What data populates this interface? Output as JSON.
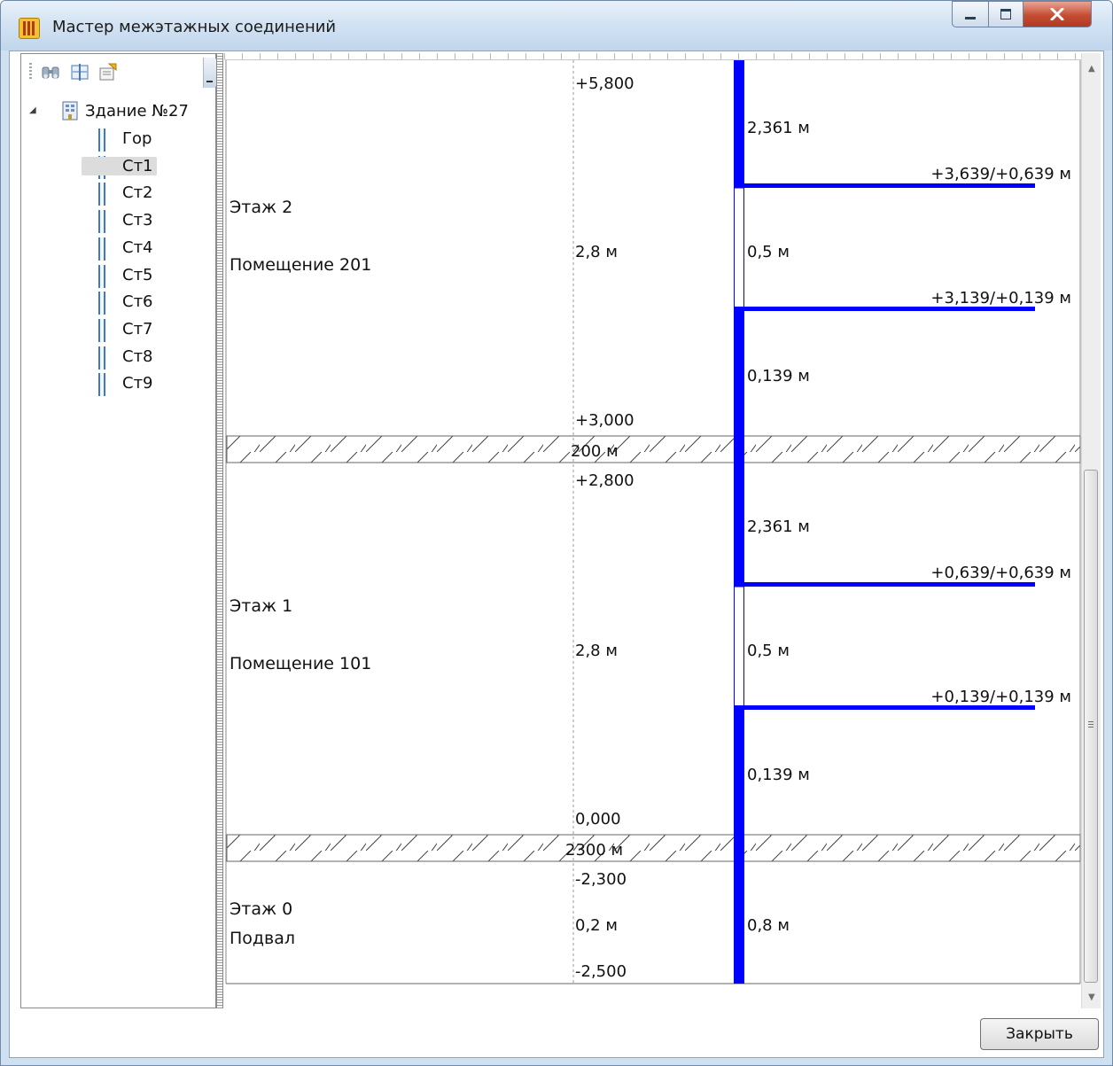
{
  "window": {
    "title": "Мастер межэтажных соединений"
  },
  "toolbar": {
    "icons": [
      "binoculars-icon",
      "split-view-icon",
      "properties-icon"
    ]
  },
  "tree": {
    "building": "Здание №27",
    "items": [
      "Гор",
      "Ст1",
      "Ст2",
      "Ст3",
      "Ст4",
      "Ст5",
      "Ст6",
      "Ст7",
      "Ст8",
      "Ст9"
    ],
    "selected": "Ст1"
  },
  "diagram": {
    "floors": [
      {
        "name": "Этаж 2",
        "room": "Помещение 201",
        "top_mark": "+5,800",
        "height": "2,8 м",
        "bottom_mark": "+3,000",
        "upper_segment": "2,361 м",
        "mid_segment": "0,5 м",
        "lower_segment": "0,139 м",
        "upper_outlet": "+3,639/+0,639 м",
        "lower_outlet": "+3,139/+0,139 м"
      },
      {
        "name": "Этаж 1",
        "room": "Помещение 101",
        "top_mark": "+2,800",
        "height": "2,8 м",
        "bottom_mark": "0,000",
        "upper_segment": "2,361 м",
        "mid_segment": "0,5 м",
        "lower_segment": "0,139 м",
        "upper_outlet": "+0,639/+0,639 м",
        "lower_outlet": "+0,139/+0,139 м"
      },
      {
        "name": "Этаж 0",
        "room": "Подвал",
        "top_mark": "-2,300",
        "height": "0,2 м",
        "bottom_mark": "-2,500",
        "segment": "0,8 м"
      }
    ],
    "slabs": [
      "200 м",
      "2300 м"
    ],
    "pipe_color": "#0000ff"
  },
  "footer": {
    "close_label": "Закрыть"
  }
}
